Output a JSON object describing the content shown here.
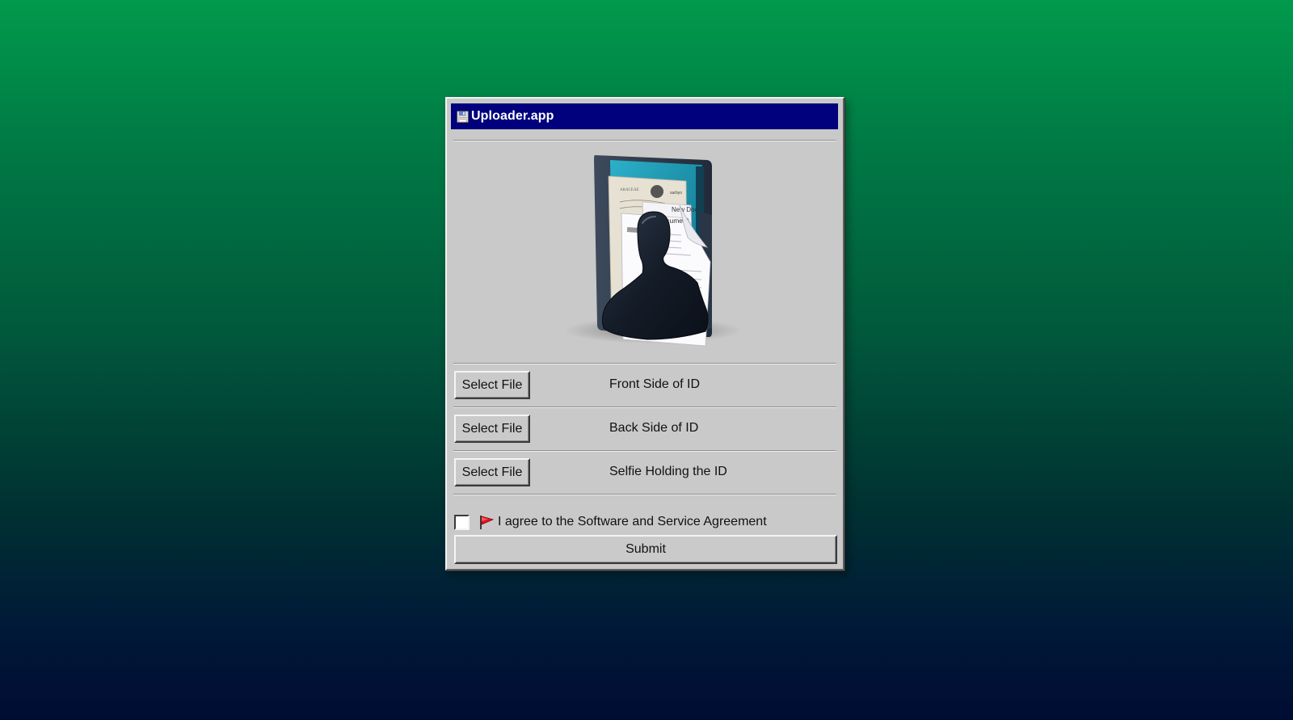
{
  "window": {
    "title": "Uploader.app",
    "title_icon": "floppy-disk-icon",
    "hero_image": "documents-folder-person-icon"
  },
  "uploads": [
    {
      "button_label": "Select File",
      "label": "Front Side of ID"
    },
    {
      "button_label": "Select File",
      "label": "Back Side of ID"
    },
    {
      "button_label": "Select File",
      "label": "Selfie Holding the ID"
    }
  ],
  "agreement": {
    "checked": false,
    "icon": "red-flag-icon",
    "label": "I agree to the Software and Service Agreement"
  },
  "submit_label": "Submit",
  "colors": {
    "titlebar": "#01017d",
    "window_bg": "#c9c9c9",
    "background_top": "#019a4c",
    "background_bottom": "#010c33"
  }
}
